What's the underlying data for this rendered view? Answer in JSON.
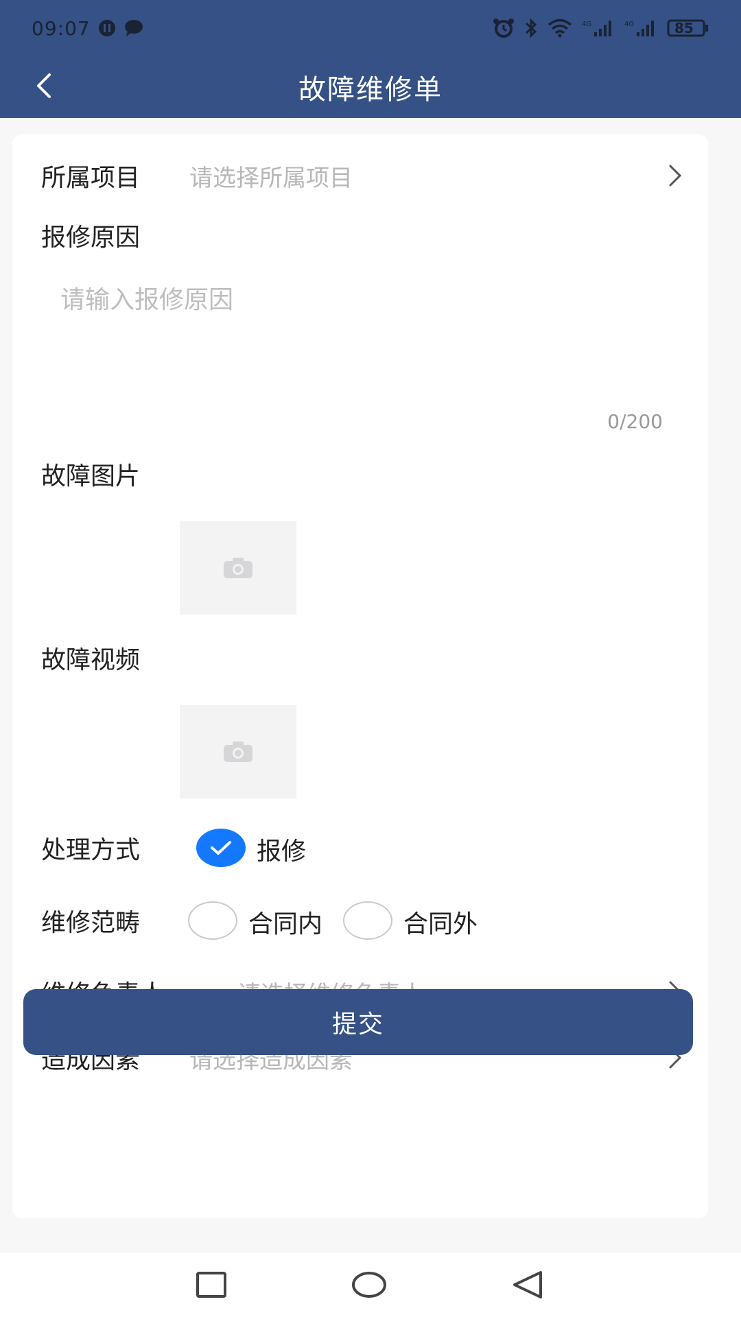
{
  "status_bar": {
    "time": "09:07",
    "battery": "85",
    "icons": [
      "alarm-icon",
      "bluetooth-icon",
      "wifi-icon",
      "signal-4g-icon",
      "signal-4g-icon",
      "battery-icon"
    ]
  },
  "header": {
    "title": "故障维修单",
    "back_icon": "back-arrow-icon",
    "bg_color": "#355185"
  },
  "form": {
    "project": {
      "label": "所属项目",
      "placeholder": "请选择所属项目"
    },
    "reason": {
      "label": "报修原因",
      "placeholder": "请输入报修原因",
      "counter": "0/200"
    },
    "fault_image": {
      "label": "故障图片",
      "icon": "camera-icon"
    },
    "fault_video": {
      "label": "故障视频",
      "icon": "camera-icon"
    },
    "handling": {
      "label": "处理方式",
      "option": "报修",
      "checked": true
    },
    "scope": {
      "label": "维修范畴",
      "options": [
        {
          "label": "合同内",
          "checked": false
        },
        {
          "label": "合同外",
          "checked": false
        }
      ]
    },
    "owner": {
      "label": "维修负责人",
      "placeholder": "请选择维修负责人"
    },
    "cause": {
      "label": "造成因素",
      "placeholder": "请选择造成因素"
    }
  },
  "submit": {
    "label": "提交",
    "color": "#355185"
  },
  "nav": {
    "buttons": [
      "recent-apps-icon",
      "home-icon",
      "back-icon"
    ]
  },
  "colors": {
    "accent": "#1479ff",
    "placeholder": "#b7b7b7"
  }
}
